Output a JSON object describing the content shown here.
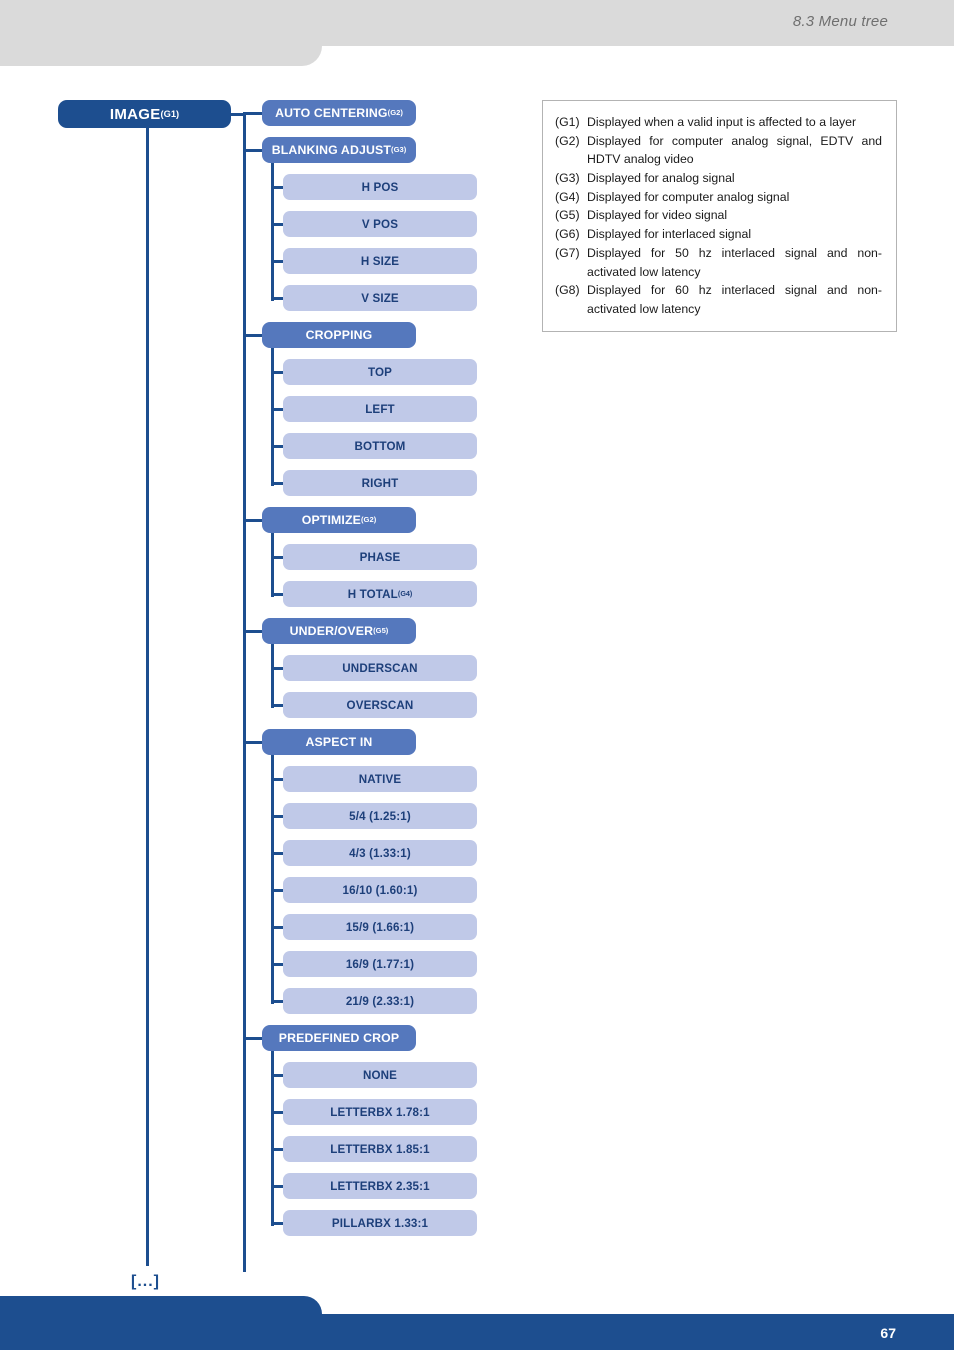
{
  "header": {
    "title": "8.3 Menu tree"
  },
  "footer": {
    "page_number": "67"
  },
  "colors": {
    "root_box": "#1d4e8f",
    "section_box": "#5578bd",
    "leaf_box": "#c0c9e8",
    "leaf_text": "#1d3f7a",
    "connector": "#1d4e8f",
    "header_band": "#dadada",
    "header_text": "#6f6f6f",
    "legend_border": "#b3b3b3"
  },
  "tree": {
    "root": {
      "label": "IMAGE",
      "note": "(G1)"
    },
    "continuation": "[...]",
    "sections": [
      {
        "label": "AUTO CENTERING",
        "note": "(G2)",
        "children": []
      },
      {
        "label": "BLANKING ADJUST",
        "note": "(G3)",
        "children": [
          {
            "label": "H POS",
            "note": ""
          },
          {
            "label": "V POS",
            "note": ""
          },
          {
            "label": "H SIZE",
            "note": ""
          },
          {
            "label": "V SIZE",
            "note": ""
          }
        ]
      },
      {
        "label": "CROPPING",
        "note": "",
        "children": [
          {
            "label": "TOP",
            "note": ""
          },
          {
            "label": "LEFT",
            "note": ""
          },
          {
            "label": "BOTTOM",
            "note": ""
          },
          {
            "label": "RIGHT",
            "note": ""
          }
        ]
      },
      {
        "label": "OPTIMIZE",
        "note": "(G2)",
        "children": [
          {
            "label": "PHASE",
            "note": ""
          },
          {
            "label": "H TOTAL",
            "note": "(G4)"
          }
        ]
      },
      {
        "label": "UNDER/OVER",
        "note": "(G5)",
        "children": [
          {
            "label": "UNDERSCAN",
            "note": ""
          },
          {
            "label": "OVERSCAN",
            "note": ""
          }
        ]
      },
      {
        "label": "ASPECT IN",
        "note": "",
        "children": [
          {
            "label": "NATIVE",
            "note": ""
          },
          {
            "label": "5/4 (1.25:1)",
            "note": ""
          },
          {
            "label": "4/3 (1.33:1)",
            "note": ""
          },
          {
            "label": "16/10 (1.60:1)",
            "note": ""
          },
          {
            "label": "15/9 (1.66:1)",
            "note": ""
          },
          {
            "label": "16/9 (1.77:1)",
            "note": ""
          },
          {
            "label": "21/9 (2.33:1)",
            "note": ""
          }
        ]
      },
      {
        "label": "PREDEFINED CROP",
        "note": "",
        "children": [
          {
            "label": "NONE",
            "note": ""
          },
          {
            "label": "LETTERBX 1.78:1",
            "note": ""
          },
          {
            "label": "LETTERBX 1.85:1",
            "note": ""
          },
          {
            "label": "LETTERBX 2.35:1",
            "note": ""
          },
          {
            "label": "PILLARBX 1.33:1",
            "note": ""
          }
        ]
      }
    ]
  },
  "legend": {
    "entries": [
      {
        "tag": "(G1)",
        "text": "Displayed when a valid input is affected to a layer"
      },
      {
        "tag": "(G2)",
        "text": "Displayed for computer analog signal, EDTV and HDTV analog video"
      },
      {
        "tag": "(G3)",
        "text": "Displayed for analog signal"
      },
      {
        "tag": "(G4)",
        "text": "Displayed for computer analog signal"
      },
      {
        "tag": "(G5)",
        "text": "Displayed for video signal"
      },
      {
        "tag": "(G6)",
        "text": "Displayed for interlaced signal"
      },
      {
        "tag": "(G7)",
        "text": "Displayed for 50 hz interlaced signal and non-activated low latency"
      },
      {
        "tag": "(G8)",
        "text": "Displayed for 60 hz interlaced signal and non-activated low latency"
      }
    ]
  }
}
